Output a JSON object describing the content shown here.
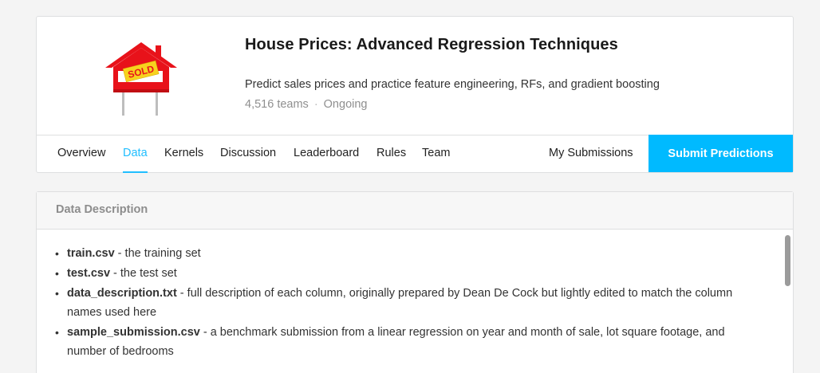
{
  "competition": {
    "title": "House Prices: Advanced Regression Techniques",
    "subtitle": "Predict sales prices and practice feature engineering, RFs, and gradient boosting",
    "teams": "4,516 teams",
    "separator": "·",
    "status": "Ongoing",
    "logo_icon": "sold-house-sign-icon",
    "logo_text": "SOLD"
  },
  "nav": {
    "tabs": [
      {
        "label": "Overview",
        "active": false
      },
      {
        "label": "Data",
        "active": true
      },
      {
        "label": "Kernels",
        "active": false
      },
      {
        "label": "Discussion",
        "active": false
      },
      {
        "label": "Leaderboard",
        "active": false
      },
      {
        "label": "Rules",
        "active": false
      },
      {
        "label": "Team",
        "active": false
      }
    ],
    "my_submissions": "My Submissions",
    "submit_label": "Submit Predictions"
  },
  "data_section": {
    "header": "Data Description",
    "files": [
      {
        "name": "train.csv",
        "description": " - the training set"
      },
      {
        "name": "test.csv",
        "description": " - the test set"
      },
      {
        "name": "data_description.txt",
        "description": " - full description of each column, originally prepared by Dean De Cock but lightly edited to match the column names used here"
      },
      {
        "name": "sample_submission.csv",
        "description": " - a benchmark submission from a linear regression on year and month of sale, lot square footage, and number of bedrooms"
      }
    ]
  },
  "colors": {
    "accent": "#20beff",
    "button": "#00baff",
    "sign_red": "#e8121a",
    "sign_yellow": "#f7d21e"
  }
}
